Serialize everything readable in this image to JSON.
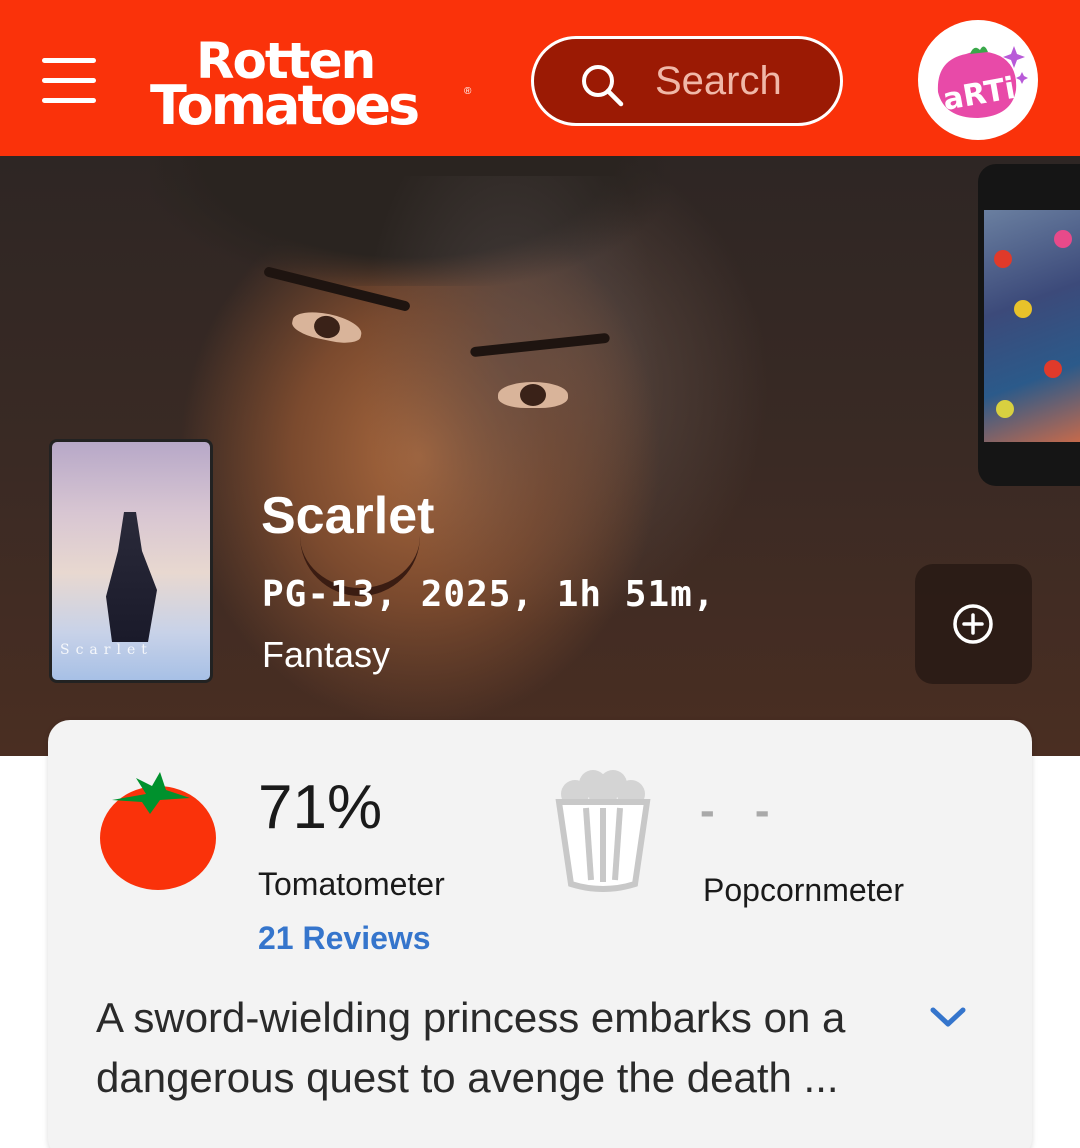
{
  "header": {
    "logo_line1": "Rotten",
    "logo_line2": "Tomatoes",
    "logo_reg": "®",
    "search_placeholder": "Search",
    "avatar_text": "aRTi",
    "brand_color": "#fa320a"
  },
  "movie": {
    "title": "Scarlet",
    "meta": "PG-13, 2025, 1h 51m,",
    "genre": "Fantasy",
    "poster_title": "Scarlet"
  },
  "scores": {
    "tomatometer_value": "71%",
    "tomatometer_label": "Tomatometer",
    "reviews_link": "21 Reviews",
    "popcornmeter_value": "- -",
    "popcornmeter_label": "Popcornmeter"
  },
  "synopsis": {
    "text": "A sword-wielding princess embarks on a dangerous quest to avenge the death ..."
  },
  "icons": {
    "menu": "hamburger-menu-icon",
    "search": "search-icon",
    "add": "plus-circle-icon",
    "tomato": "fresh-tomato-icon",
    "popcorn": "popcorn-bucket-icon",
    "expand": "chevron-down-icon"
  }
}
